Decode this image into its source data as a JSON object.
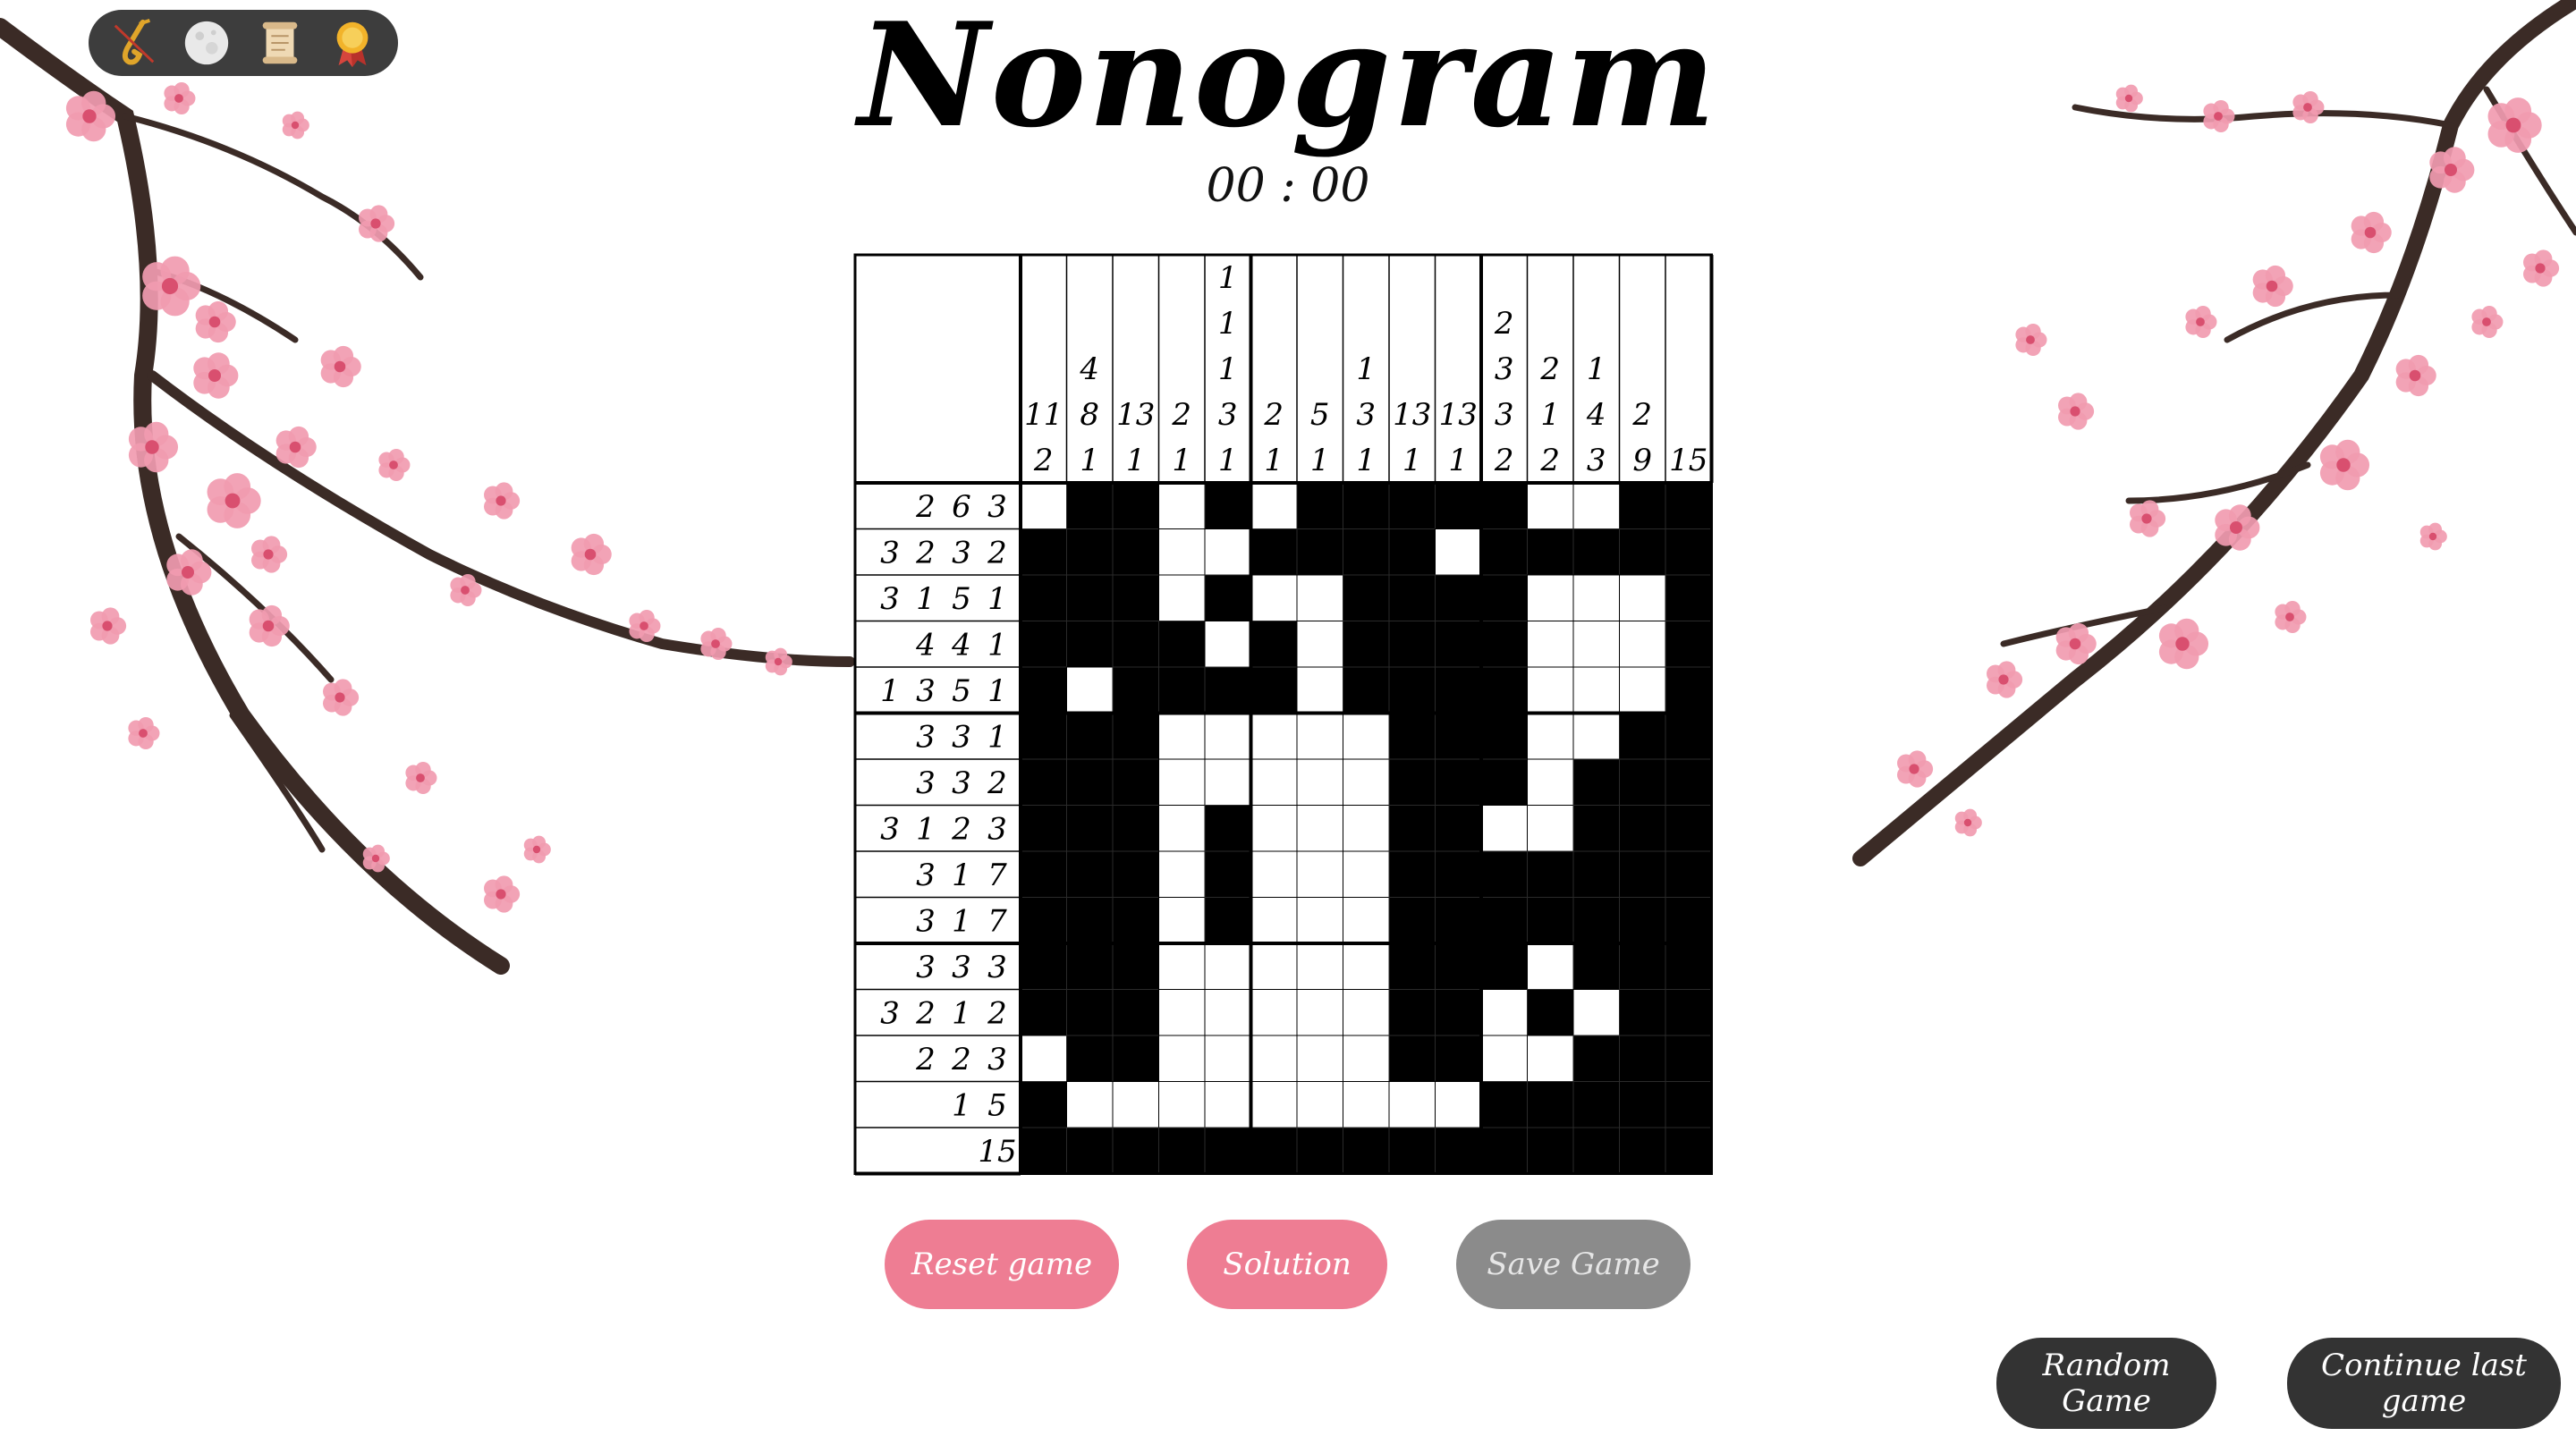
{
  "title": "Nonogram",
  "timer": "00 : 00",
  "toolbar": {
    "icons": [
      "saxophone-icon",
      "moon-icon",
      "scroll-icon",
      "medal-icon"
    ]
  },
  "buttons": {
    "reset": "Reset game",
    "solution": "Solution",
    "save": "Save Game",
    "random": "Random Game",
    "continue": "Continue last game"
  },
  "colors": {
    "filled": "#000000",
    "pink_button": "#ee7d93",
    "grey_button": "#8b8b8b",
    "dark_button": "#333333",
    "toolbar": "#3d3d3d",
    "blossom": "#f19bb0",
    "branch": "#3b2b26"
  },
  "puzzle": {
    "size": 15,
    "column_clues": [
      [
        "11",
        "2"
      ],
      [
        "4",
        "8",
        "1"
      ],
      [
        "13",
        "1"
      ],
      [
        "2",
        "1"
      ],
      [
        "1",
        "1",
        "1",
        "3",
        "1"
      ],
      [
        "2",
        "1"
      ],
      [
        "5",
        "1"
      ],
      [
        "1",
        "3",
        "1"
      ],
      [
        "13",
        "1"
      ],
      [
        "13",
        "1"
      ],
      [
        "2",
        "3",
        "3",
        "2"
      ],
      [
        "2",
        "1",
        "2"
      ],
      [
        "1",
        "4",
        "3"
      ],
      [
        "2",
        "9"
      ],
      [
        "15"
      ]
    ],
    "row_clues": [
      [
        "2",
        "6",
        "3"
      ],
      [
        "3",
        "2",
        "3",
        "2"
      ],
      [
        "3",
        "1",
        "5",
        "1"
      ],
      [
        "4",
        "4",
        "1"
      ],
      [
        "1",
        "3",
        "5",
        "1"
      ],
      [
        "3",
        "3",
        "1"
      ],
      [
        "3",
        "3",
        "2"
      ],
      [
        "3",
        "1",
        "2",
        "3"
      ],
      [
        "3",
        "1",
        "7"
      ],
      [
        "3",
        "1",
        "7"
      ],
      [
        "3",
        "3",
        "3"
      ],
      [
        "3",
        "2",
        "1",
        "2"
      ],
      [
        "2",
        "2",
        "3"
      ],
      [
        "1",
        "5"
      ],
      [
        "15"
      ]
    ],
    "cells": [
      "011010111110011",
      "111001111011111",
      "111010011110001",
      "111101011110001",
      "101111011110001",
      "111000001110011",
      "111000001110111",
      "111010001100111",
      "111010001111111",
      "111010001111111",
      "111000001110111",
      "111000001101011",
      "011000001100111",
      "100000000011111",
      "111111111111111"
    ]
  }
}
